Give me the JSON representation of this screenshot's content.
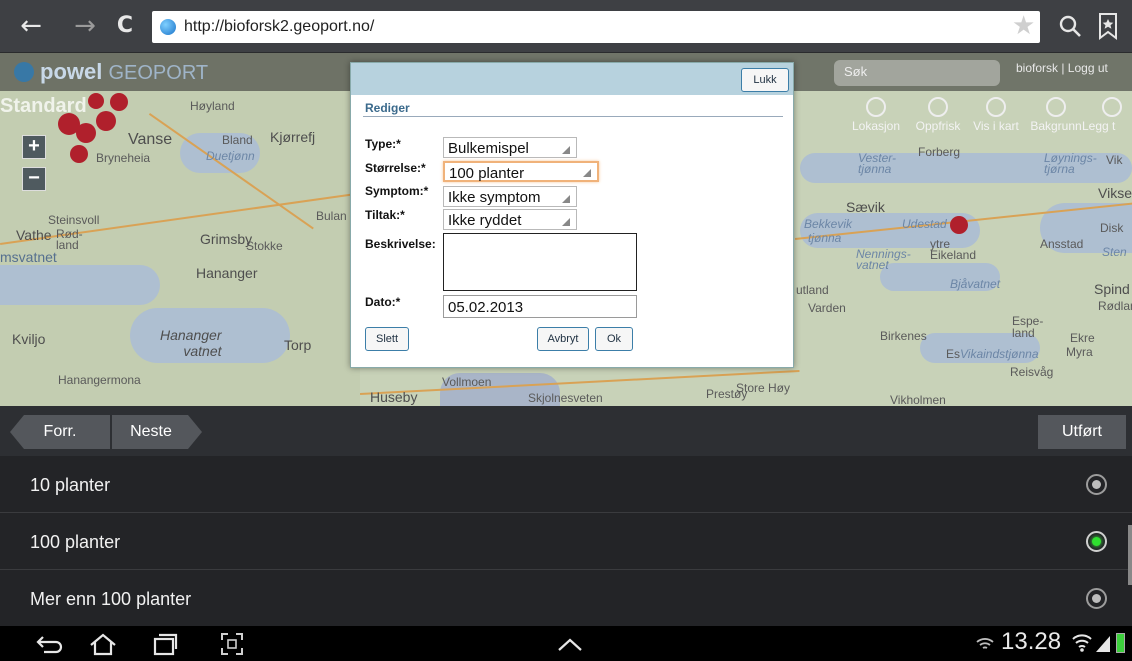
{
  "browser": {
    "back_glyph": "←",
    "forward_glyph": "→",
    "reload_glyph": "C",
    "url": "http://bioforsk2.geoport.no/",
    "star_glyph": "★",
    "icons": [
      "back-arrow-icon",
      "forward-arrow-icon",
      "reload-icon",
      "globe-icon",
      "star-icon",
      "search-icon",
      "bookmark-icon"
    ]
  },
  "app": {
    "logo_main": "powel",
    "logo_sub": "GEOPORT",
    "search_placeholder": "Søk",
    "user_links": "bioforsk | Logg ut",
    "map_style": "Standard",
    "toolbar": [
      "Lokasjon",
      "Oppfrisk",
      "Vis i kart",
      "Bakgrunn",
      "Legg t"
    ],
    "zoom_in": "+",
    "zoom_out": "−"
  },
  "map_labels": {
    "hoyland": "Høyland",
    "vanse": "Vanse",
    "bland": "Bland",
    "kjorrefj": "Kjørrefj",
    "bryneheia": "Bryneheia",
    "duetjonn": "Duetjønn",
    "vathe": "Vathe",
    "steinsvoll": "Steinsvoll",
    "rod_land": "Rød-\nland",
    "grimsby": "Grimsby",
    "stokke": "Stokke",
    "msvatnet": "msvatnet",
    "hananger": "Hananger",
    "bulan": "Bulan",
    "kviljo": "Kviljo",
    "hananger_vatnet": "Hananger\nvatnet",
    "torp": "Torp",
    "hanangermona": "Hanangermona",
    "huseby": "Huseby",
    "vollmoen": "Vollmoen",
    "skjolnesveten": "Skjolnesveten",
    "prestoy": "Prestøy",
    "store_hoy": "Store Høy",
    "vikholmen": "Vikholmen",
    "forberg": "Forberg",
    "vester_tjonna": "Vester-\ntjønna",
    "loyning_tjorna": "Løynings-\ntjørna",
    "vik": "Vik",
    "vikse": "Vikse",
    "saevik": "Sævik",
    "bekkevik": "Bekkevik",
    "udestad": "Udestad",
    "tjonna": "tjønna",
    "ytre_eikeland": "ytre\nEikeland",
    "nennings_vatnet": "Nennings-\nvatnet",
    "bjavatnet": "Bjåvatnet",
    "utland": "utland",
    "varden": "Varden",
    "ansstad": "Ansstad",
    "disk": "Disk",
    "sten": "Sten",
    "spind": "Spind",
    "rodland": "Rødland",
    "espe_land": "Espe-\nland",
    "ekre": "Ekre",
    "myra": "Myra",
    "birkenes": "Birkenes",
    "es": "Es",
    "vikaindstjonna": "Vikaindstjønna",
    "reisvag": "Reisvåg"
  },
  "dialog": {
    "close_label": "Lukk",
    "title": "Rediger",
    "fields": [
      {
        "label": "Type:*",
        "value": "Bulkemispel"
      },
      {
        "label": "Størrelse:*",
        "value": "100 planter"
      },
      {
        "label": "Symptom:*",
        "value": "Ikke symptom"
      },
      {
        "label": "Tiltak:*",
        "value": "Ikke ryddet"
      }
    ],
    "description_label": "Beskrivelse:",
    "description_value": "",
    "date_label": "Dato:*",
    "date_value": "05.02.2013",
    "delete_label": "Slett",
    "cancel_label": "Avbryt",
    "ok_label": "Ok"
  },
  "picker": {
    "prev_label": "Forr.",
    "next_label": "Neste",
    "done_label": "Utført",
    "options": [
      {
        "label": "10 planter",
        "selected": false
      },
      {
        "label": "100 planter",
        "selected": true
      },
      {
        "label": "Mer enn 100 planter",
        "selected": false
      }
    ]
  },
  "system": {
    "back_glyph": "⮌",
    "home_glyph": "⌂",
    "recent_glyph": "▭",
    "screenshot_glyph": "⛶",
    "up_glyph": "︿",
    "clock": "13.28",
    "colors": {
      "selected_radio": "#2fe12f",
      "dialog_header": "#b7d2de",
      "active_field_border": "#f0b27a"
    }
  }
}
